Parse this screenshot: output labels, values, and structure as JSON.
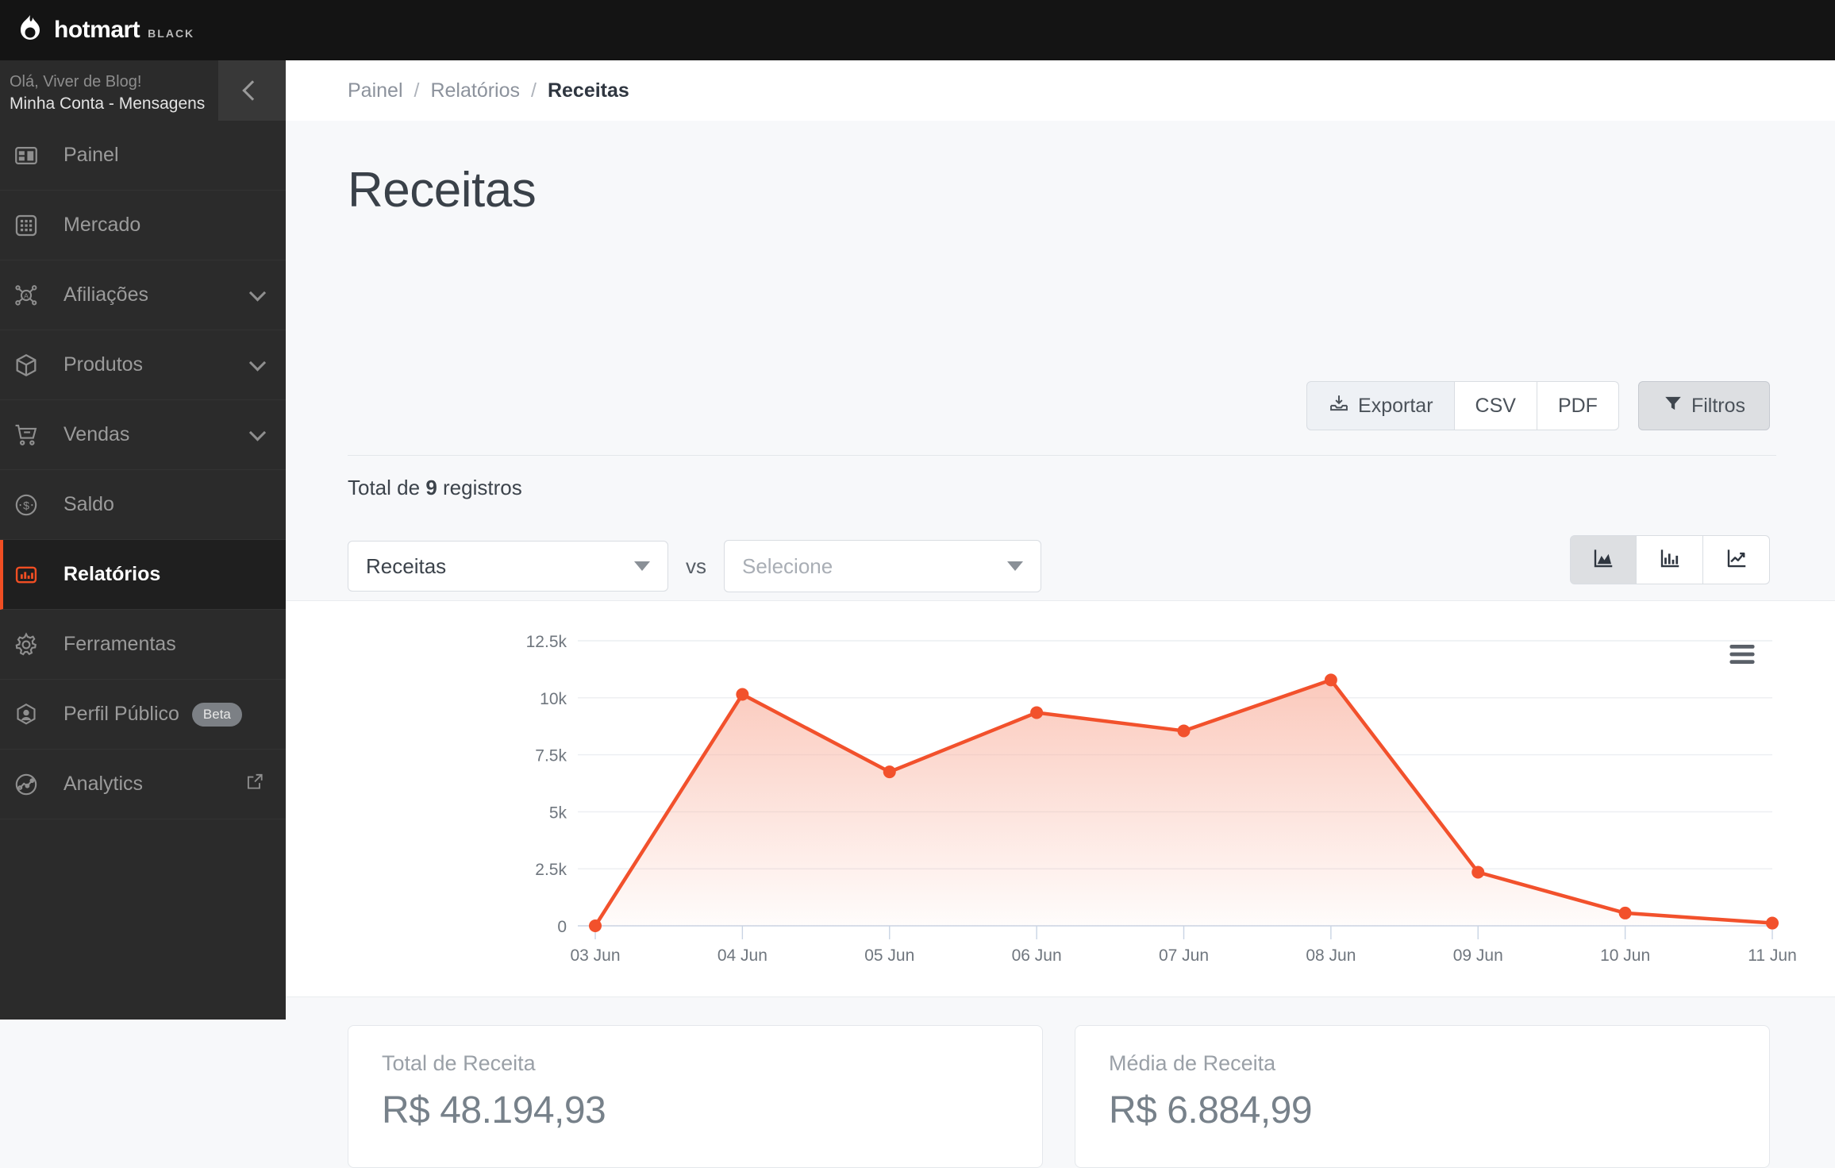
{
  "brand": {
    "name": "hotmart",
    "tier": "BLACK",
    "logo_icon": "flame-icon"
  },
  "sidebar": {
    "greeting": "Olá, Viver de Blog!",
    "account": "Minha Conta - Mensagens",
    "collapse_icon": "chevron-left-icon",
    "items": [
      {
        "label": "Painel",
        "icon": "dashboard-icon",
        "caret": false,
        "badge": "",
        "external": false,
        "active": false
      },
      {
        "label": "Mercado",
        "icon": "grid-icon",
        "caret": false,
        "badge": "",
        "external": false,
        "active": false
      },
      {
        "label": "Afiliações",
        "icon": "affiliate-network-icon",
        "caret": true,
        "badge": "",
        "external": false,
        "active": false
      },
      {
        "label": "Produtos",
        "icon": "box-icon",
        "caret": true,
        "badge": "",
        "external": false,
        "active": false
      },
      {
        "label": "Vendas",
        "icon": "shopping-cart-icon",
        "caret": true,
        "badge": "",
        "external": false,
        "active": false
      },
      {
        "label": "Saldo",
        "icon": "dollar-circle-icon",
        "caret": false,
        "badge": "",
        "external": false,
        "active": false
      },
      {
        "label": "Relatórios",
        "icon": "bar-chart-icon",
        "caret": false,
        "badge": "",
        "external": false,
        "active": true
      },
      {
        "label": "Ferramentas",
        "icon": "gear-icon",
        "caret": false,
        "badge": "",
        "external": false,
        "active": false
      },
      {
        "label": "Perfil Público",
        "icon": "user-circle-icon",
        "caret": false,
        "badge": "Beta",
        "external": false,
        "active": false
      },
      {
        "label": "Analytics",
        "icon": "analytics-icon",
        "caret": false,
        "badge": "",
        "external": true,
        "active": false
      }
    ]
  },
  "breadcrumb": {
    "level1": "Painel",
    "sep1": "/",
    "level2": "Relatórios",
    "sep2": "/",
    "current": "Receitas"
  },
  "page": {
    "title": "Receitas",
    "total_text_prefix": "Total de",
    "total_count": "9",
    "total_text_suffix": "registros"
  },
  "toolbar": {
    "export_label": "Exportar",
    "export_icon": "export-icon",
    "csv_label": "CSV",
    "pdf_label": "PDF",
    "filters_label": "Filtros",
    "filters_icon": "funnel-icon"
  },
  "selects": {
    "primary_value": "Receitas",
    "vs_label": "vs",
    "secondary_placeholder": "Selecione",
    "caret_icon": "chevron-down-icon"
  },
  "chart_toggle": {
    "area_icon": "area-chart-icon",
    "bar_icon": "bar-chart-icon",
    "line_icon": "line-chart-icon",
    "active": "area"
  },
  "chart_menu_icon": "hamburger-menu-icon",
  "chart_data": {
    "type": "area",
    "title": "",
    "xlabel": "",
    "ylabel": "",
    "categories": [
      "03 Jun",
      "04 Jun",
      "05 Jun",
      "06 Jun",
      "07 Jun",
      "08 Jun",
      "09 Jun",
      "10 Jun",
      "11 Jun"
    ],
    "series": [
      {
        "name": "Receitas",
        "values": [
          0,
          10150,
          6750,
          9350,
          8550,
          10780,
          2350,
          560,
          120
        ]
      }
    ],
    "ytick_labels": [
      "0",
      "2.5k",
      "5k",
      "7.5k",
      "10k",
      "12.5k"
    ],
    "ytick_values": [
      0,
      2500,
      5000,
      7500,
      10000,
      12500
    ],
    "ylim": [
      0,
      12500
    ],
    "grid": true,
    "legend": false,
    "line_color": "#f2512c",
    "fill_color": "#f9b4a2"
  },
  "cards": [
    {
      "label": "Total de Receita",
      "value": "R$ 48.194,93"
    },
    {
      "label": "Média de Receita",
      "value": "R$ 6.884,99"
    }
  ],
  "colors": {
    "accent": "#f04e23",
    "sidebar_bg": "#2b2b2b",
    "topbar_bg": "#141414"
  }
}
